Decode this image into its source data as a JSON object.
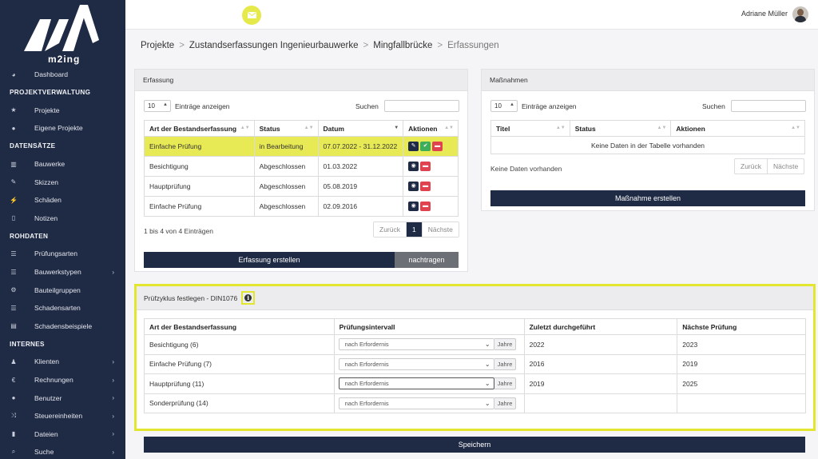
{
  "app": {
    "logo_text": "m2ing"
  },
  "topbar": {
    "user_name": "Adriane Müller"
  },
  "sidebar": {
    "dashboard": "Dashboard",
    "sections": [
      {
        "title": "PROJEKTVERWALTUNG",
        "items": [
          {
            "label": "Projekte",
            "icon": "star-icon",
            "glyph": "★",
            "chevron": false
          },
          {
            "label": "Eigene Projekte",
            "icon": "user-icon",
            "glyph": "●",
            "chevron": false
          }
        ]
      },
      {
        "title": "DATENSÄTZE",
        "items": [
          {
            "label": "Bauwerke",
            "icon": "building-icon",
            "glyph": "▥",
            "chevron": false
          },
          {
            "label": "Skizzen",
            "icon": "pencil-square-icon",
            "glyph": "✎",
            "chevron": false
          },
          {
            "label": "Schäden",
            "icon": "bolt-icon",
            "glyph": "⚡",
            "chevron": false
          },
          {
            "label": "Notizen",
            "icon": "file-icon",
            "glyph": "▯",
            "chevron": false
          }
        ]
      },
      {
        "title": "ROHDATEN",
        "items": [
          {
            "label": "Prüfungsarten",
            "icon": "list-icon",
            "glyph": "☰",
            "chevron": false
          },
          {
            "label": "Bauwerkstypen",
            "icon": "list-icon",
            "glyph": "☰",
            "chevron": true
          },
          {
            "label": "Bauteilgruppen",
            "icon": "cogs-icon",
            "glyph": "⚙",
            "chevron": false
          },
          {
            "label": "Schadensarten",
            "icon": "list-icon",
            "glyph": "☰",
            "chevron": false
          },
          {
            "label": "Schadensbeispiele",
            "icon": "book-icon",
            "glyph": "▤",
            "chevron": false
          }
        ]
      },
      {
        "title": "INTERNES",
        "items": [
          {
            "label": "Klienten",
            "icon": "person-icon",
            "glyph": "♟",
            "chevron": true
          },
          {
            "label": "Rechnungen",
            "icon": "euro-icon",
            "glyph": "€",
            "chevron": true
          },
          {
            "label": "Benutzer",
            "icon": "users-icon",
            "glyph": "●",
            "chevron": true
          },
          {
            "label": "Steuereinheiten",
            "icon": "shuffle-icon",
            "glyph": "⤨",
            "chevron": true
          },
          {
            "label": "Dateien",
            "icon": "file-icon",
            "glyph": "▮",
            "chevron": true
          },
          {
            "label": "Suche",
            "icon": "search-icon",
            "glyph": "⌕",
            "chevron": true
          }
        ]
      }
    ]
  },
  "breadcrumb": [
    "Projekte",
    "Zustandserfassungen Ingenieurbauwerke",
    "Mingfallbrücke",
    "Erfassungen"
  ],
  "erfassung": {
    "title": "Erfassung",
    "page_size": "10",
    "show_entries": "Einträge anzeigen",
    "search_label": "Suchen",
    "columns": [
      "Art der Bestandserfassung",
      "Status",
      "Datum",
      "Aktionen"
    ],
    "rows": [
      {
        "art": "Einfache Prüfung",
        "status": "in Bearbeitung",
        "datum": "07.07.2022 - 31.12.2022"
      },
      {
        "art": "Besichtigung",
        "status": "Abgeschlossen",
        "datum": "01.03.2022"
      },
      {
        "art": "Hauptprüfung",
        "status": "Abgeschlossen",
        "datum": "05.08.2019"
      },
      {
        "art": "Einfache Prüfung",
        "status": "Abgeschlossen",
        "datum": "02.09.2016"
      }
    ],
    "info": "1 bis 4 von 4 Einträgen",
    "prev": "Zurück",
    "page": "1",
    "next": "Nächste",
    "create_button": "Erfassung erstellen",
    "nachtragen_button": "nachtragen"
  },
  "massnahmen": {
    "title": "Maßnahmen",
    "page_size": "10",
    "show_entries": "Einträge anzeigen",
    "search_label": "Suchen",
    "columns": [
      "Titel",
      "Status",
      "Aktionen"
    ],
    "empty": "Keine Daten in der Tabelle vorhanden",
    "info": "Keine Daten vorhanden",
    "prev": "Zurück",
    "next": "Nächste",
    "create_button": "Maßnahme erstellen"
  },
  "pruefzyklus": {
    "title": "Prüfzyklus festlegen - DIN1076",
    "columns": [
      "Art der Bestandserfassung",
      "Prüfungsintervall",
      "Zuletzt durchgeführt",
      "Nächste Prüfung"
    ],
    "unit": "Jahre",
    "rows": [
      {
        "art": "Besichtigung (6)",
        "interval": "nach Erfordernis",
        "last": "2022",
        "next": "2023"
      },
      {
        "art": "Einfache Prüfung (7)",
        "interval": "nach Erfordernis",
        "last": "2016",
        "next": "2019"
      },
      {
        "art": "Hauptprüfung (11)",
        "interval": "nach Erfordernis",
        "last": "2019",
        "next": "2025"
      },
      {
        "art": "Sonderprüfung (14)",
        "interval": "nach Erfordernis",
        "last": "",
        "next": ""
      }
    ],
    "save_button": "Speichern"
  },
  "colors": {
    "sidebar": "#1f2a44",
    "highlight": "#e8ea55",
    "accent_border": "#e3e62e",
    "danger": "#e0434f",
    "success": "#3fae5a"
  }
}
